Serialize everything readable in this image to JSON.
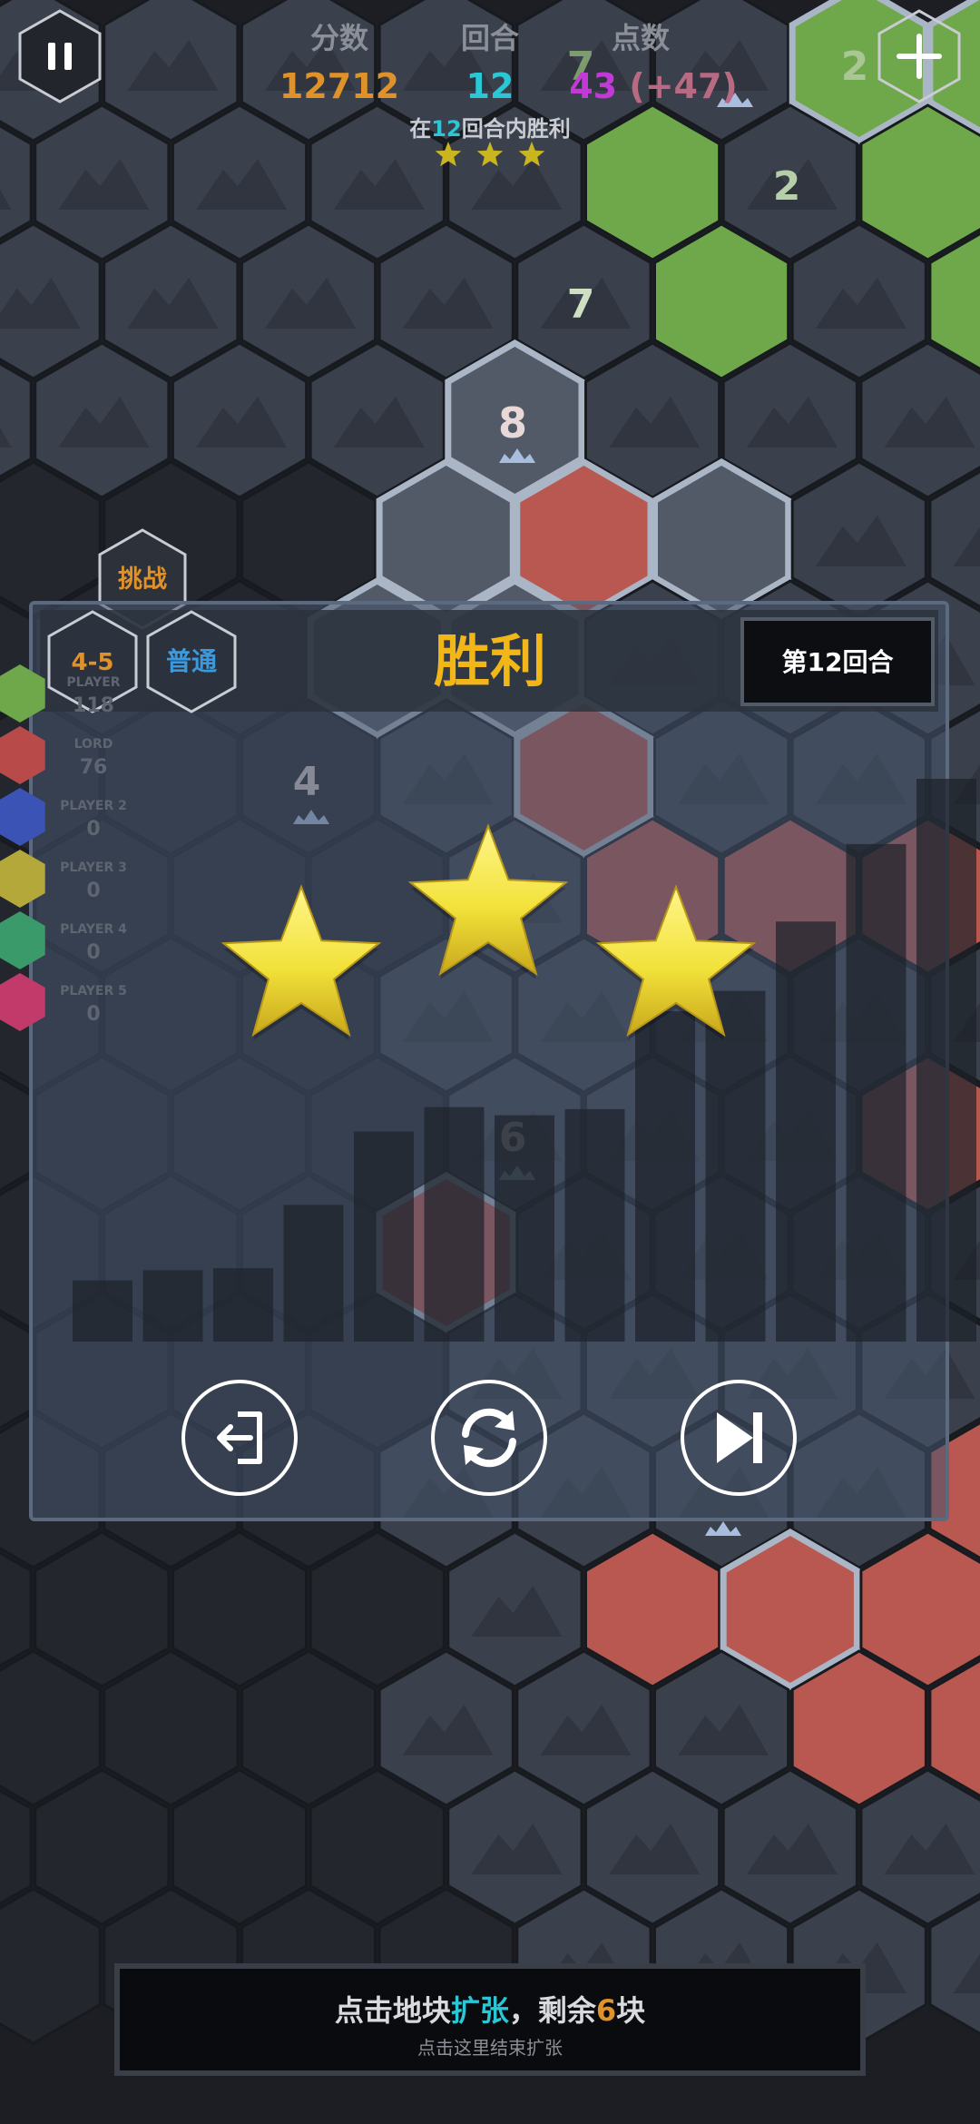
{
  "hud": {
    "score_label": "分数",
    "score_value": "12712",
    "turn_label": "回合",
    "turn_value": "12",
    "points_label": "点数",
    "points_value": "43",
    "points_delta": "(+47)",
    "goal_prefix": "在",
    "goal_turns": "12",
    "goal_suffix": "回合内胜利"
  },
  "tiles": {
    "green_7a": "7",
    "green_2a": "2",
    "green_2b": "2",
    "green_7b": "7",
    "red_8": "8",
    "red_4": "4",
    "red_6": "6"
  },
  "badges": {
    "challenge": "挑战",
    "level": "4-5",
    "difficulty": "普通"
  },
  "players": [
    {
      "name": "PLAYER",
      "value": "118",
      "color": "#6fa84a"
    },
    {
      "name": "LORD",
      "value": "76",
      "color": "#b84a4a"
    },
    {
      "name": "PLAYER 2",
      "value": "0",
      "color": "#3a53b5"
    },
    {
      "name": "PLAYER 3",
      "value": "0",
      "color": "#b5a83a"
    },
    {
      "name": "PLAYER 4",
      "value": "0",
      "color": "#3a9a6a"
    },
    {
      "name": "PLAYER 5",
      "value": "0",
      "color": "#c23a6a"
    }
  ],
  "result": {
    "title": "胜利",
    "turn_badge": "第12回合",
    "stars_earned": 3,
    "stars_total": 3
  },
  "chart_data": {
    "type": "bar",
    "values": [
      3,
      3.5,
      3.6,
      6.7,
      10.3,
      11.5,
      11.1,
      11.4,
      16.2,
      17.2,
      20.6,
      24.4,
      27.6
    ],
    "title": "",
    "xlabel": "",
    "ylabel": ""
  },
  "actions": {
    "exit_icon": "exit-icon",
    "restart_icon": "restart-icon",
    "next_icon": "next-icon"
  },
  "footer": {
    "line1_a": "点击地块",
    "line1_b": "扩张",
    "line1_c": "，剩余",
    "line1_d": "6",
    "line1_e": "块",
    "line2": "点击这里结束扩张"
  },
  "colors": {
    "score": "#e0922a",
    "turn": "#2ac8d6",
    "points": "#c23ad6",
    "points_delta": "#b86a82",
    "victory": "#f2b619",
    "green_tile": "#6fa84a",
    "red_tile": "#b85850",
    "star": "#f2e23a"
  }
}
